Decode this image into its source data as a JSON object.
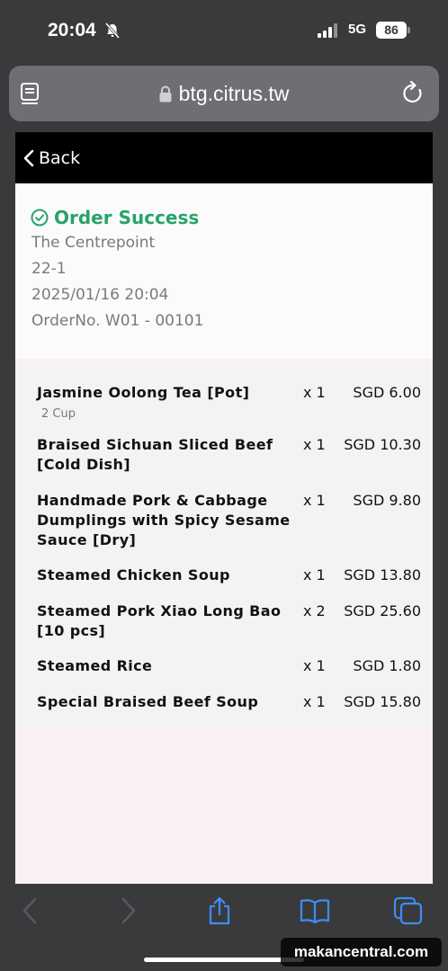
{
  "status_bar": {
    "time": "20:04",
    "network": "5G",
    "battery": "86"
  },
  "browser": {
    "url": "btg.citrus.tw"
  },
  "nav": {
    "back_label": "Back"
  },
  "order": {
    "status": "Order Success",
    "location": "The Centrepoint",
    "table": "22-1",
    "datetime": "2025/01/16 20:04",
    "order_no": "OrderNo. W01 - 00101"
  },
  "items": [
    {
      "name": "Jasmine Oolong Tea [Pot]",
      "qty": "x 1",
      "price": "SGD 6.00",
      "note": "2 Cup"
    },
    {
      "name": "Braised Sichuan Sliced Beef [Cold Dish]",
      "qty": "x 1",
      "price": "SGD 10.30"
    },
    {
      "name": "Handmade Pork & Cabbage Dumplings with Spicy Sesame Sauce [Dry]",
      "qty": "x 1",
      "price": "SGD 9.80"
    },
    {
      "name": "Steamed Chicken Soup",
      "qty": "x 1",
      "price": "SGD 13.80"
    },
    {
      "name": "Steamed Pork Xiao Long Bao [10 pcs]",
      "qty": "x 2",
      "price": "SGD 25.60"
    },
    {
      "name": "Steamed Rice",
      "qty": "x 1",
      "price": "SGD 1.80"
    },
    {
      "name": "Special Braised Beef Soup",
      "qty": "x 1",
      "price": "SGD 15.80"
    }
  ],
  "watermark": "makancentral.com",
  "colors": {
    "success": "#27a36a",
    "toolbar_icon": "#3d8ef5",
    "nav_bg": "#000000"
  }
}
